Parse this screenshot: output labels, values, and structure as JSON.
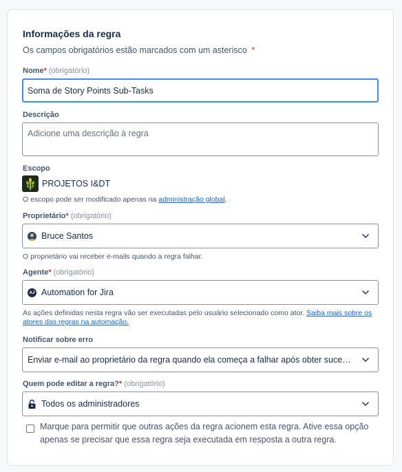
{
  "form": {
    "title": "Informações da regra",
    "subtitle": "Os campos obrigatórios estão marcados com um asterisco",
    "required_mark": "*",
    "optional_hint": "(obrigatório)",
    "name": {
      "label": "Nome",
      "value": "Soma de Story Points Sub-Tasks"
    },
    "description": {
      "label": "Descrição",
      "placeholder": "Adicione uma descrição à regra"
    },
    "scope": {
      "label": "Escopo",
      "project_icon": "project-wheat-icon",
      "project_name": "PROJETOS I&DT",
      "help_prefix": "O escopo pode ser modificado apenas na ",
      "help_link": "administração global",
      "help_suffix": "."
    },
    "owner": {
      "label": "Proprietário",
      "value": "Bruce Santos",
      "avatar_icon": "user-avatar-icon",
      "help": "O proprietário vai receber e-mails quando a regra falhar."
    },
    "agent": {
      "label": "Agente",
      "value": "Automation for Jira",
      "avatar_text": "AJ",
      "help_prefix": "As ações definidas nesta regra vão ser executadas pelo usuário selecionado como ator. ",
      "help_link": "Saiba mais sobre os atores das regras na automação."
    },
    "notify": {
      "label": "Notificar sobre erro",
      "value": "Enviar e-mail ao proprietário da regra quando ela começa a falhar após obter sucesso"
    },
    "editors": {
      "label": "Quem pode editar a regra?",
      "value": "Todos os administradores",
      "icon": "lock-icon"
    },
    "allow_trigger": {
      "checked": false,
      "label": "Marque para permitir que outras ações da regra acionem esta regra. Ative essa opção apenas se precisar que essa regra seja executada em resposta a outra regra."
    }
  },
  "colors": {
    "focus_border": "#388bff",
    "link": "#0c66e4",
    "required": "#c9372c"
  }
}
